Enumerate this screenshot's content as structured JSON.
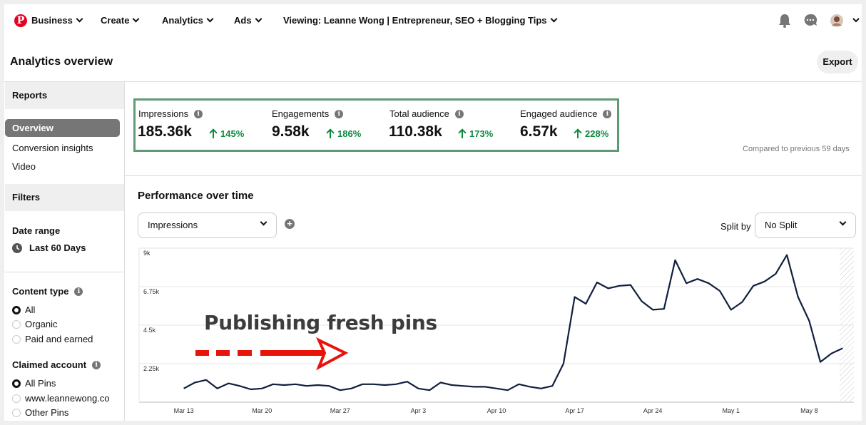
{
  "topnav": {
    "business": "Business",
    "create": "Create",
    "analytics": "Analytics",
    "ads": "Ads",
    "viewing": "Viewing: Leanne Wong | Entrepreneur, SEO + Blogging Tips"
  },
  "page": {
    "title": "Analytics overview",
    "export_label": "Export"
  },
  "sidebar": {
    "reports_heading": "Reports",
    "reports": [
      "Overview",
      "Conversion insights",
      "Video"
    ],
    "active_report": "Overview",
    "filters_heading": "Filters",
    "date_range_label": "Date range",
    "date_range_value": "Last 60 Days",
    "content_type_label": "Content type",
    "content_type_options": [
      "All",
      "Organic",
      "Paid and earned"
    ],
    "content_type_selected": "All",
    "claimed_account_label": "Claimed account",
    "claimed_account_options": [
      "All Pins",
      "www.leannewong.co",
      "Other Pins"
    ],
    "claimed_account_selected": "All Pins"
  },
  "metrics": [
    {
      "label": "Impressions",
      "value": "185.36k",
      "change": "145%"
    },
    {
      "label": "Engagements",
      "value": "9.58k",
      "change": "186%"
    },
    {
      "label": "Total audience",
      "value": "110.38k",
      "change": "173%"
    },
    {
      "label": "Engaged audience",
      "value": "6.57k",
      "change": "228%"
    }
  ],
  "compared_note": "Compared to previous 59 days",
  "performance": {
    "title": "Performance over time",
    "metric_select": "Impressions",
    "split_by_label": "Split by",
    "split_select": "No Split"
  },
  "annotation": {
    "text": "Publishing fresh pins",
    "color": "#e8140c"
  },
  "colors": {
    "accent_green": "#0a8a3d",
    "highlight_box": "#5e9b74",
    "line": "#0f1f3d",
    "pinterest_red": "#e60023"
  },
  "chart_data": {
    "type": "line",
    "title": "",
    "xlabel": "",
    "ylabel": "",
    "ylim": [
      0,
      9000
    ],
    "y_ticks": [
      "9k",
      "6.75k",
      "4.5k",
      "2.25k"
    ],
    "y_tick_values": [
      9000,
      6750,
      4500,
      2250
    ],
    "x_ticks": [
      "Mar 13",
      "Mar 20",
      "Mar 27",
      "Apr 3",
      "Apr 10",
      "Apr 17",
      "Apr 24",
      "May 1",
      "May 8"
    ],
    "x_tick_days": [
      0,
      7,
      14,
      21,
      28,
      35,
      42,
      49,
      56
    ],
    "x_day_range": [
      -4,
      60
    ],
    "grid": true,
    "legend": "none",
    "series": [
      {
        "values": [
          [
            0,
            800
          ],
          [
            1,
            1150
          ],
          [
            2,
            1300
          ],
          [
            3,
            800
          ],
          [
            4,
            1100
          ],
          [
            5,
            950
          ],
          [
            6,
            750
          ],
          [
            7,
            800
          ],
          [
            8,
            1050
          ],
          [
            9,
            1000
          ],
          [
            10,
            1050
          ],
          [
            11,
            950
          ],
          [
            12,
            1000
          ],
          [
            13,
            950
          ],
          [
            14,
            700
          ],
          [
            15,
            800
          ],
          [
            16,
            1050
          ],
          [
            17,
            1050
          ],
          [
            18,
            1000
          ],
          [
            19,
            1050
          ],
          [
            20,
            1200
          ],
          [
            21,
            800
          ],
          [
            22,
            700
          ],
          [
            23,
            1150
          ],
          [
            24,
            1000
          ],
          [
            25,
            950
          ],
          [
            26,
            900
          ],
          [
            27,
            900
          ],
          [
            28,
            800
          ],
          [
            29,
            700
          ],
          [
            30,
            1050
          ],
          [
            31,
            900
          ],
          [
            32,
            800
          ],
          [
            33,
            950
          ],
          [
            34,
            2250
          ],
          [
            35,
            6150
          ],
          [
            36,
            5750
          ],
          [
            37,
            7000
          ],
          [
            38,
            6650
          ],
          [
            39,
            6800
          ],
          [
            40,
            6850
          ],
          [
            41,
            5900
          ],
          [
            42,
            5400
          ],
          [
            43,
            5450
          ],
          [
            44,
            8300
          ],
          [
            45,
            6950
          ],
          [
            46,
            7200
          ],
          [
            47,
            6950
          ],
          [
            48,
            6500
          ],
          [
            49,
            5400
          ],
          [
            50,
            5850
          ],
          [
            51,
            6800
          ],
          [
            52,
            7050
          ],
          [
            53,
            7500
          ],
          [
            54,
            8600
          ],
          [
            55,
            6150
          ],
          [
            56,
            4750
          ],
          [
            57,
            2350
          ],
          [
            58,
            2850
          ],
          [
            59,
            3150
          ]
        ]
      }
    ]
  }
}
